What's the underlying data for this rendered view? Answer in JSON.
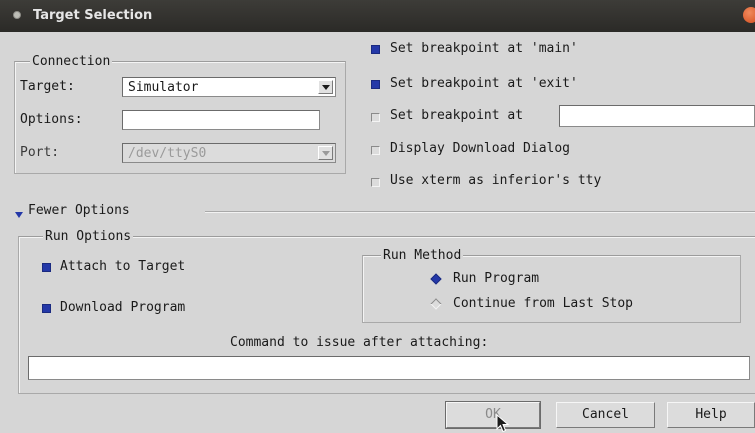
{
  "window": {
    "title": "Target Selection"
  },
  "connection": {
    "legend": "Connection",
    "target_label": "Target:",
    "target_value": "Simulator",
    "options_label": "Options:",
    "options_value": "",
    "port_label": "Port:",
    "port_value": "/dev/ttyS0"
  },
  "checkboxes": [
    {
      "label": "Set breakpoint at 'main'",
      "checked": true
    },
    {
      "label": "Set breakpoint at 'exit'",
      "checked": true
    },
    {
      "label": "Set breakpoint at",
      "checked": false,
      "input_value": ""
    },
    {
      "label": "Display Download Dialog",
      "checked": false
    },
    {
      "label": "Use xterm as inferior's tty",
      "checked": false
    }
  ],
  "fewer_options_label": "Fewer Options",
  "run_options": {
    "legend": "Run Options",
    "attach_label": "Attach to Target",
    "attach_checked": true,
    "download_label": "Download Program",
    "download_checked": true
  },
  "run_method": {
    "legend": "Run Method",
    "options": [
      {
        "label": "Run Program",
        "selected": true
      },
      {
        "label": "Continue from Last Stop",
        "selected": false
      }
    ]
  },
  "command": {
    "label": "Command to issue after attaching:",
    "value": ""
  },
  "buttons": {
    "ok": "OK",
    "cancel": "Cancel",
    "help": "Help"
  },
  "colors": {
    "titlebar": "#2f2e2b",
    "background": "#d6d6d6",
    "accent": "#2438a8",
    "close": "#e0592a"
  }
}
